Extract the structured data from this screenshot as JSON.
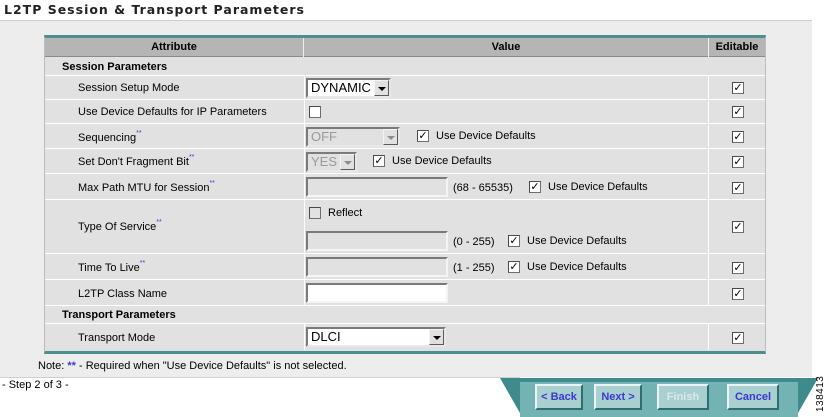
{
  "page": {
    "title": "L2TP Session & Transport Parameters"
  },
  "table": {
    "headers": {
      "attribute": "Attribute",
      "value": "Value",
      "editable": "Editable"
    },
    "sections": {
      "session": "Session Parameters",
      "transport": "Transport Parameters"
    },
    "rows": {
      "session_setup_mode": {
        "label": "Session Setup Mode",
        "value": "DYNAMIC",
        "editable": true
      },
      "use_device_defaults_ip": {
        "label": "Use Device Defaults for IP Parameters",
        "checked": false,
        "editable": true
      },
      "sequencing": {
        "label": "Sequencing",
        "value": "OFF",
        "use_defaults_label": "Use Device Defaults",
        "use_defaults": true,
        "editable": true
      },
      "dont_fragment": {
        "label": "Set Don't Fragment Bit",
        "value": "YES",
        "use_defaults_label": "Use Device Defaults",
        "use_defaults": true,
        "editable": true
      },
      "max_path_mtu": {
        "label": "Max Path MTU for Session",
        "value": "",
        "range": "(68 - 65535)",
        "use_defaults_label": "Use Device Defaults",
        "use_defaults": true,
        "editable": true
      },
      "type_of_service": {
        "label": "Type Of Service",
        "reflect_label": "Reflect",
        "reflect": false,
        "value": "",
        "range": "(0 - 255)",
        "use_defaults_label": "Use Device Defaults",
        "use_defaults": true,
        "editable": true
      },
      "time_to_live": {
        "label": "Time To Live",
        "value": "",
        "range": "(1 - 255)",
        "use_defaults_label": "Use Device Defaults",
        "use_defaults": true,
        "editable": true
      },
      "l2tp_class_name": {
        "label": "L2TP Class Name",
        "value": "",
        "editable": true
      },
      "transport_mode": {
        "label": "Transport Mode",
        "value": "DLCI",
        "editable": true
      }
    },
    "required_marker": "**"
  },
  "note": {
    "prefix": "Note: ",
    "stars": "**",
    "text": " - Required when \"Use Device Defaults\" is not selected."
  },
  "wizard": {
    "step": "- Step 2 of 3 -",
    "back": "< Back",
    "next": "Next >",
    "finish": "Finish",
    "cancel": "Cancel"
  },
  "figure_id": "138413",
  "colors": {
    "accent": "#3f8a8c",
    "link": "#3a3ad0"
  }
}
